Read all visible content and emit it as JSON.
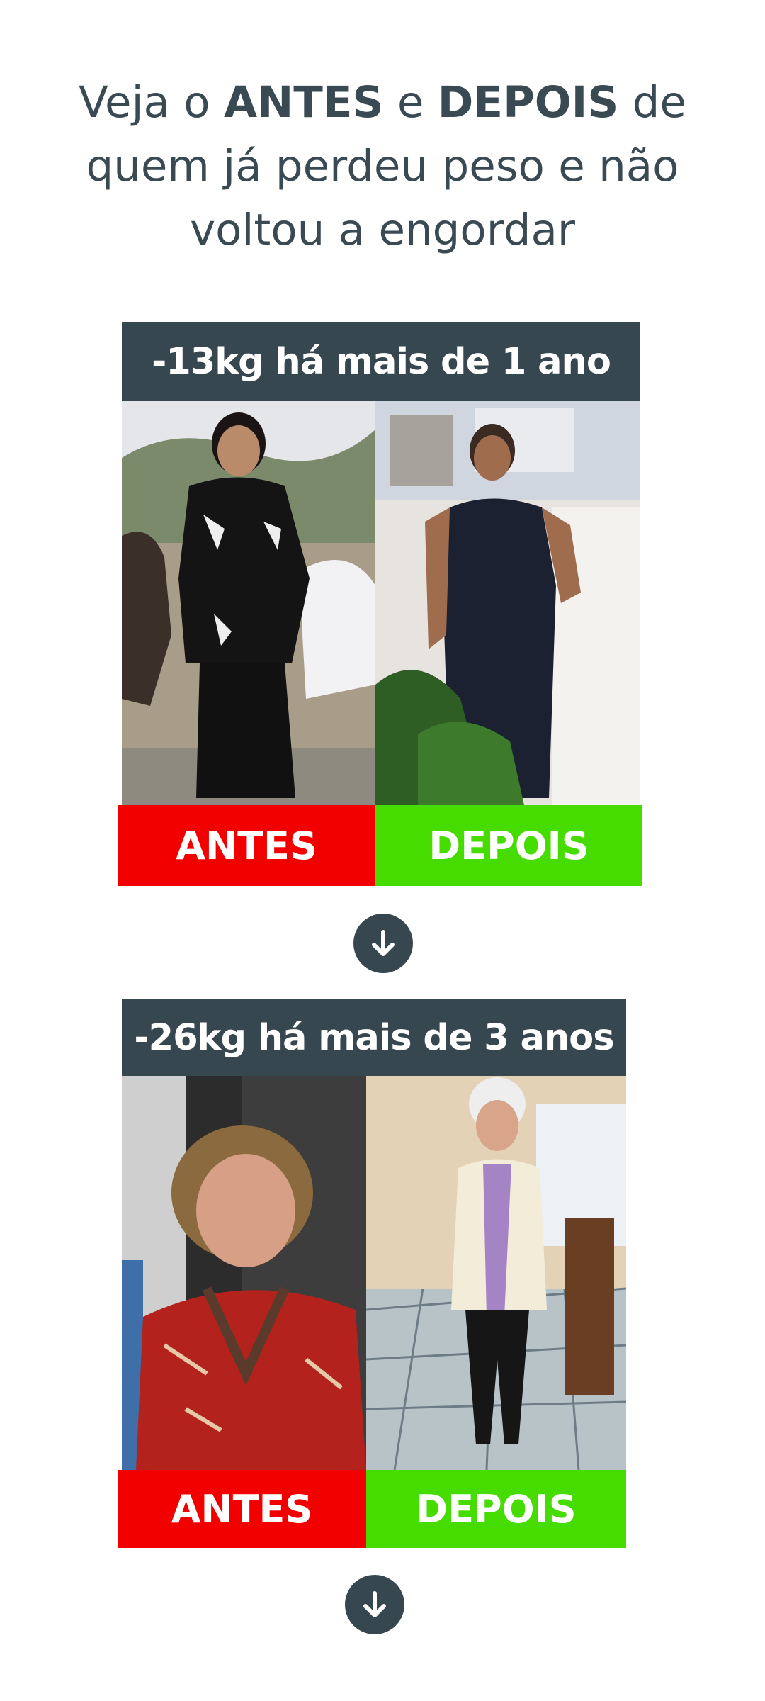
{
  "headline": {
    "part1": "Veja o ",
    "bold1": "ANTES",
    "part2": " e ",
    "bold2": "DEPOIS",
    "part3": " de quem já perdeu peso e não voltou a engordar"
  },
  "testimonials": [
    {
      "title": "-13kg há mais de 1 ano",
      "before_label": "ANTES",
      "after_label": "DEPOIS"
    },
    {
      "title": "-26kg há mais de 3 anos",
      "before_label": "ANTES",
      "after_label": "DEPOIS"
    }
  ],
  "icons": {
    "scroll": "arrow-down-circle-icon"
  },
  "colors": {
    "heading": "#3a4a53",
    "title_bar": "#37474f",
    "before": "#f20000",
    "after": "#46dc00"
  }
}
